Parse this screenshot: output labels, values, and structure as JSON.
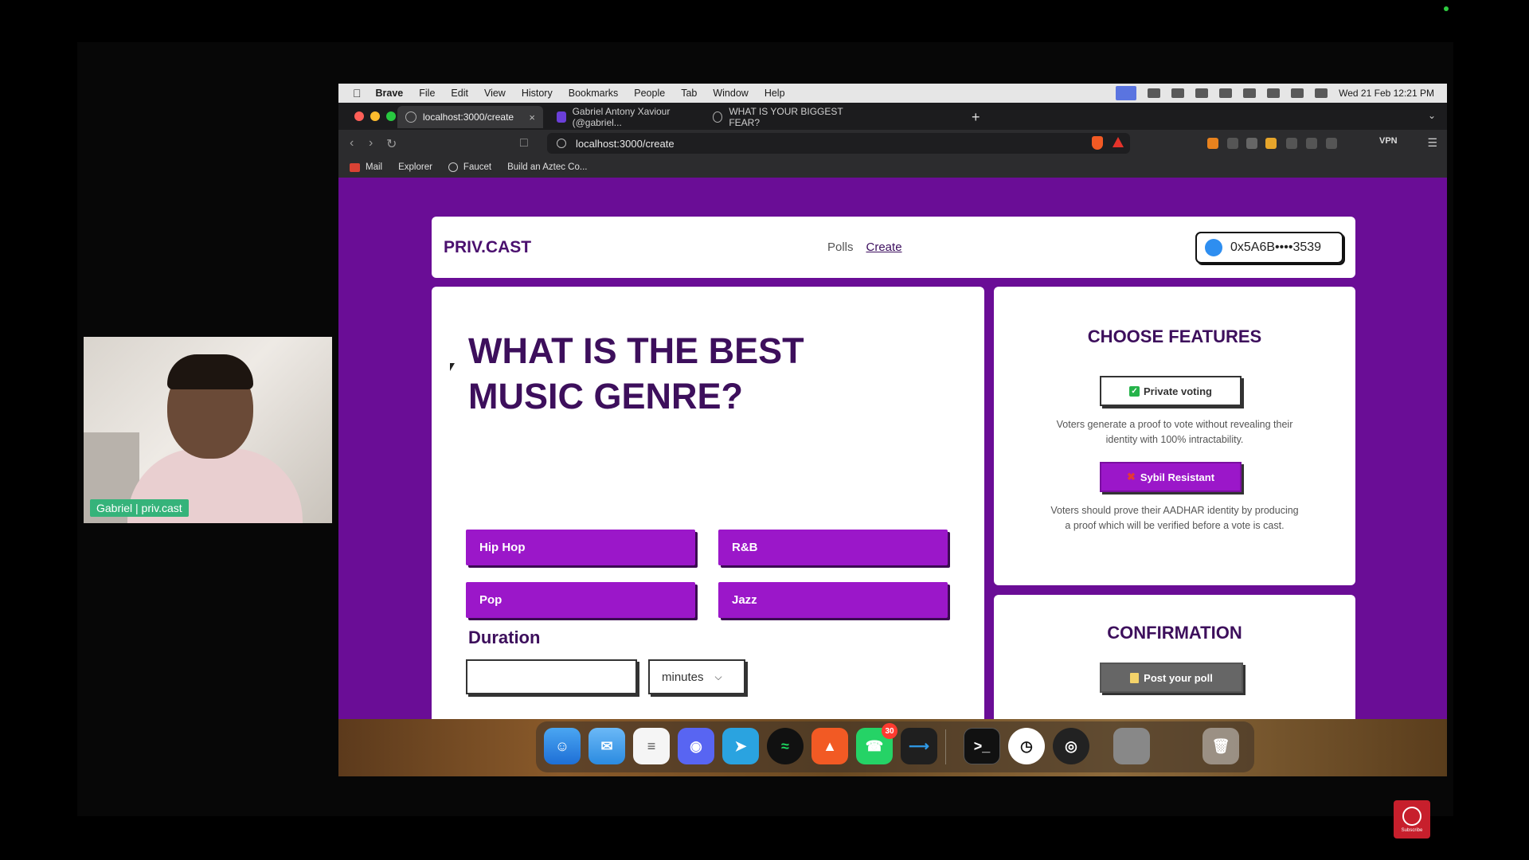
{
  "webcam": {
    "label": "Gabriel | priv.cast"
  },
  "menubar": {
    "app": "Brave",
    "items": [
      "File",
      "Edit",
      "View",
      "History",
      "Bookmarks",
      "People",
      "Tab",
      "Window",
      "Help"
    ],
    "datetime": "Wed 21 Feb  12:21 PM"
  },
  "tabs": [
    {
      "title": "localhost:3000/create",
      "close": "×"
    },
    {
      "title": "Gabriel Antony Xaviour (@gabriel..."
    },
    {
      "title": "WHAT IS YOUR BIGGEST FEAR?"
    }
  ],
  "newtab": "+",
  "toolbar": {
    "url": "localhost:3000/create",
    "vpn": "VPN"
  },
  "bookmarks": [
    "Mail",
    "Explorer",
    "Faucet",
    "Build an Aztec Co..."
  ],
  "app": {
    "brand": "PRIV.CAST",
    "nav": {
      "polls": "Polls",
      "create": "Create"
    },
    "wallet": "0x5A6B••••3539"
  },
  "poll": {
    "question": "WHAT IS THE BEST MUSIC GENRE?",
    "options": [
      "Hip Hop",
      "R&B",
      "Pop",
      "Jazz"
    ],
    "duration_label": "Duration",
    "duration_value": "",
    "duration_unit": "minutes"
  },
  "features": {
    "title": "CHOOSE FEATURES",
    "private_label": "Private voting",
    "private_desc": "Voters generate a proof to vote without revealing their identity with 100% intractability.",
    "sybil_label": "Sybil Resistant",
    "sybil_desc": "Voters should prove their AADHAR identity by producing a proof which will be verified before a vote is cast."
  },
  "confirmation": {
    "title": "CONFIRMATION",
    "post_label": "Post your poll"
  },
  "dock": {
    "whatsapp_badge": "30"
  },
  "subscribe": "Subscribe",
  "colors": {
    "page_bg": "#6a0d96",
    "accent": "#9b17c9",
    "heading": "#3d0f5c"
  }
}
